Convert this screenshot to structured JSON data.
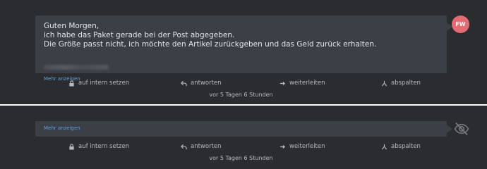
{
  "messages": [
    {
      "lines": [
        "Guten Morgen,",
        "ich habe das Paket gerade bei der Post abgegeben.",
        "Die Größe passt nicht, ich möchte den Artikel zurückgeben und das Geld zurück erhalten."
      ],
      "show_more": "Mehr anzeigen",
      "avatar_initials": "FW",
      "avatar_color": "#e56b73",
      "actions": {
        "internal": "auf intern setzen",
        "reply": "antworten",
        "forward": "weiterleiten",
        "split": "abspalten"
      },
      "timestamp": "vor 5 Tagen 6 Stunden"
    },
    {
      "show_more": "Mehr anzeigen",
      "actions": {
        "internal": "auf intern setzen",
        "reply": "antworten",
        "forward": "weiterleiten",
        "split": "abspalten"
      },
      "timestamp": "vor 5 Tagen 6 Stunden"
    }
  ],
  "colors": {
    "background": "#2b2c30",
    "bubble": "#3b3f46",
    "link": "#5ba3d9",
    "divider": "#ffffff"
  },
  "icons": [
    "lock-icon",
    "reply-icon",
    "forward-arrow-icon",
    "split-icon",
    "eye-slash-icon"
  ]
}
